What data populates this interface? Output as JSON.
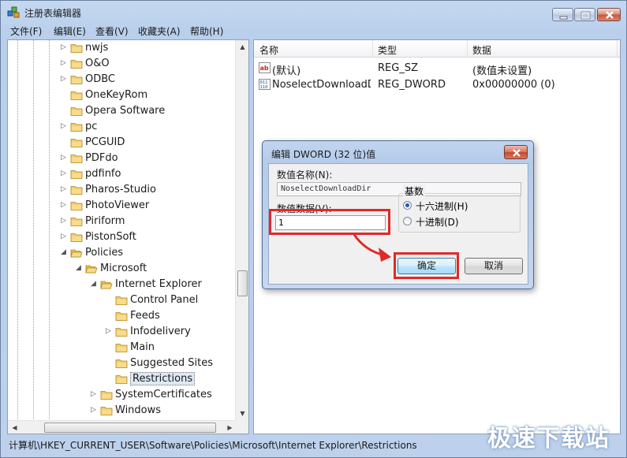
{
  "window": {
    "title": "注册表编辑器"
  },
  "menu": [
    {
      "label": "文件(F)"
    },
    {
      "label": "编辑(E)"
    },
    {
      "label": "查看(V)"
    },
    {
      "label": "收藏夹(A)"
    },
    {
      "label": "帮助(H)"
    }
  ],
  "tree": [
    {
      "label": "nwjs",
      "level": 0,
      "expander": "collapsed"
    },
    {
      "label": "O&O",
      "level": 0,
      "expander": "collapsed"
    },
    {
      "label": "ODBC",
      "level": 0,
      "expander": "collapsed"
    },
    {
      "label": "OneKeyRom",
      "level": 0,
      "expander": "none"
    },
    {
      "label": "Opera Software",
      "level": 0,
      "expander": "none"
    },
    {
      "label": "pc",
      "level": 0,
      "expander": "collapsed"
    },
    {
      "label": "PCGUID",
      "level": 0,
      "expander": "none"
    },
    {
      "label": "PDFdo",
      "level": 0,
      "expander": "collapsed"
    },
    {
      "label": "pdfinfo",
      "level": 0,
      "expander": "collapsed"
    },
    {
      "label": "Pharos-Studio",
      "level": 0,
      "expander": "collapsed"
    },
    {
      "label": "PhotoViewer",
      "level": 0,
      "expander": "collapsed"
    },
    {
      "label": "Piriform",
      "level": 0,
      "expander": "collapsed"
    },
    {
      "label": "PistonSoft",
      "level": 0,
      "expander": "collapsed"
    },
    {
      "label": "Policies",
      "level": 0,
      "expander": "expanded"
    },
    {
      "label": "Microsoft",
      "level": 1,
      "expander": "expanded"
    },
    {
      "label": "Internet Explorer",
      "level": 2,
      "expander": "expanded"
    },
    {
      "label": "Control Panel",
      "level": 3,
      "expander": "none"
    },
    {
      "label": "Feeds",
      "level": 3,
      "expander": "none"
    },
    {
      "label": "Infodelivery",
      "level": 3,
      "expander": "collapsed"
    },
    {
      "label": "Main",
      "level": 3,
      "expander": "none"
    },
    {
      "label": "Suggested Sites",
      "level": 3,
      "expander": "none"
    },
    {
      "label": "Restrictions",
      "level": 3,
      "expander": "none",
      "selected": true
    },
    {
      "label": "SystemCertificates",
      "level": 2,
      "expander": "collapsed"
    },
    {
      "label": "Windows",
      "level": 2,
      "expander": "collapsed"
    }
  ],
  "list": {
    "columns": [
      "名称",
      "类型",
      "数据"
    ],
    "rows": [
      {
        "icon": "string-value-icon",
        "name": "(默认)",
        "type": "REG_SZ",
        "data": "(数值未设置)"
      },
      {
        "icon": "dword-value-icon",
        "name": "NoselectDownloadDir",
        "type": "REG_DWORD",
        "data": "0x00000000 (0)"
      }
    ]
  },
  "dialog": {
    "title": "编辑 DWORD (32 位)值",
    "value_name_label": "数值名称(N):",
    "value_name": "NoselectDownloadDir",
    "value_data_label": "数值数据(V):",
    "value_data": "1",
    "base_label": "基数",
    "radio_hex": "十六进制(H)",
    "radio_dec": "十进制(D)",
    "ok": "确定",
    "cancel": "取消"
  },
  "status": {
    "path": "计算机\\HKEY_CURRENT_USER\\Software\\Policies\\Microsoft\\Internet Explorer\\Restrictions"
  },
  "watermark": "极速下载站",
  "colors": {
    "highlight_red": "#e02a2a",
    "window_frame": "#c5d8f1"
  }
}
